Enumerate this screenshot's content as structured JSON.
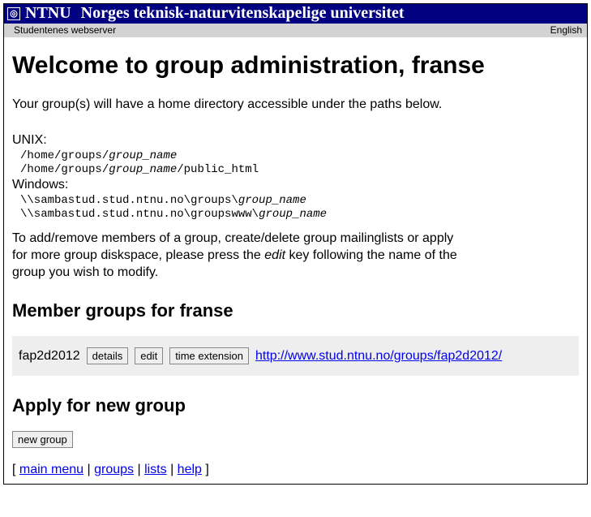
{
  "banner": {
    "brand": "NTNU",
    "title": "Norges teknisk-naturvitenskapelige universitet"
  },
  "subbar": {
    "left": "Studentenes webserver",
    "right": "English"
  },
  "heading": "Welcome to group administration, franse",
  "intro": "Your group(s) will have a home directory accessible under the paths below.",
  "paths": {
    "unix_label": "UNIX:",
    "unix1_prefix": "/home/groups/",
    "unix1_italic": "group_name",
    "unix2_prefix": "/home/groups/",
    "unix2_italic": "group_name",
    "unix2_suffix": "/public_html",
    "win_label": "Windows:",
    "win1_prefix": "\\\\sambastud.stud.ntnu.no\\groups\\",
    "win1_italic": "group_name",
    "win2_prefix": "\\\\sambastud.stud.ntnu.no\\groupswww\\",
    "win2_italic": "group_name"
  },
  "instructions_pre": "To add/remove members of a group, create/delete group mailinglists or apply for more group diskspace, please press the ",
  "instructions_em": "edit",
  "instructions_post": " key following the name of the group you wish to modify.",
  "member_heading": "Member groups for franse",
  "group": {
    "name": "fap2d2012",
    "details": "details",
    "edit": "edit",
    "time_ext": "time extension",
    "url": "http://www.stud.ntnu.no/groups/fap2d2012/"
  },
  "apply_heading": "Apply for new group",
  "new_group_btn": "new group",
  "footer": {
    "main_menu": "main menu",
    "groups": "groups",
    "lists": "lists",
    "help": "help"
  }
}
